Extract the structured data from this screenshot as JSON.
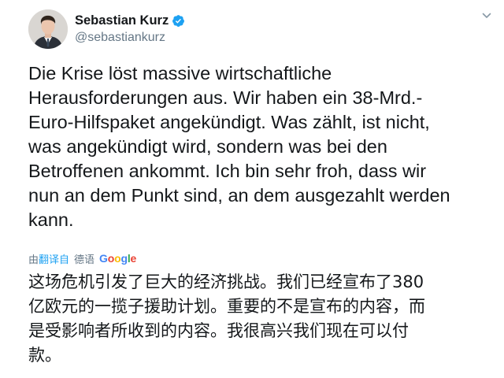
{
  "author": {
    "display_name": "Sebastian Kurz",
    "handle": "@sebastiankurz",
    "verified_icon": "verified-badge-icon",
    "avatar_icon": "profile-photo"
  },
  "tweet": {
    "text_lines": [
      "Die Krise löst massive wirtschaftliche",
      "Herausforderungen aus. Wir haben ein 38-Mrd.-",
      "Euro-Hilfspaket angekündigt. Was zählt, ist nicht,",
      "was angekündigt wird, sondern was bei den",
      "Betroffenen ankommt. Ich bin sehr froh, dass wir",
      "nun an dem Punkt sind, an dem ausgezahlt werden",
      "kann."
    ]
  },
  "translation": {
    "by_label": "由",
    "translate_link": "翻译自",
    "source_language": "德语",
    "provider": "Google",
    "text_lines": [
      "这场危机引发了巨大的经济挑战。我们已经宣布了380",
      "亿欧元的一揽子援助计划。重要的不是宣布的内容，而",
      "是受影响者所收到的内容。我很高兴我们现在可以付",
      "款。"
    ]
  },
  "colors": {
    "text": "#14171a",
    "secondary": "#657786",
    "accent": "#1da1f2"
  }
}
